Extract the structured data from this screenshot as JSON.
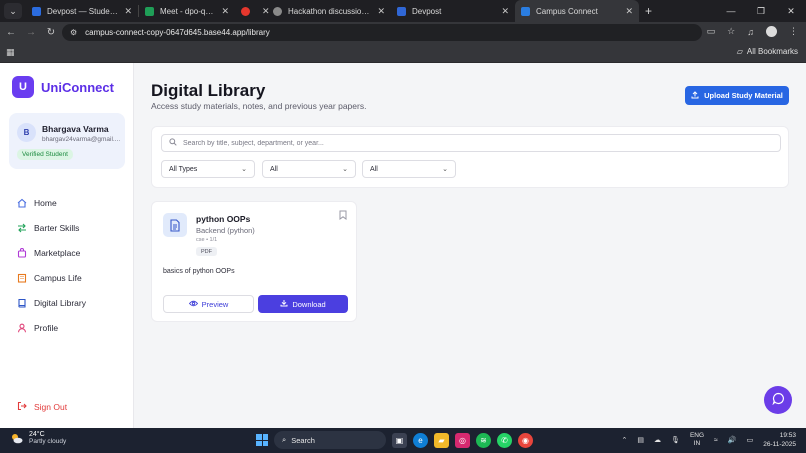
{
  "browser": {
    "tabs": [
      {
        "title": "Devpost — Student Guide for H",
        "color": "#2b6cdf",
        "active": false
      },
      {
        "title": "Meet - dpo-qcyk-fah",
        "color": "#1f9e57",
        "active": false
      },
      {
        "title": "",
        "color": "#e5372d",
        "active": false
      },
      {
        "title": "Hackathon discussion topics",
        "color": "#8a8a8a",
        "active": false
      },
      {
        "title": "Devpost",
        "color": "#3067d6",
        "active": false
      },
      {
        "title": "Campus Connect",
        "color": "#2a7de1",
        "active": true
      }
    ],
    "url": "campus-connect-copy-0647d645.base44.app/library",
    "bookmarks_label": "All Bookmarks"
  },
  "app": {
    "brand_letter": "U",
    "brand_name": "UniConnect",
    "user": {
      "initial": "B",
      "name": "Bhargava Varma",
      "email": "bhargav24varma@gmail....",
      "badge": "Verified Student"
    },
    "nav": [
      {
        "label": "Home",
        "icon": "home-icon"
      },
      {
        "label": "Barter Skills",
        "icon": "swap-icon"
      },
      {
        "label": "Marketplace",
        "icon": "shopping-bag-icon"
      },
      {
        "label": "Campus Life",
        "icon": "building-icon"
      },
      {
        "label": "Digital Library",
        "icon": "book-icon"
      },
      {
        "label": "Profile",
        "icon": "user-icon"
      }
    ],
    "signout": "Sign Out"
  },
  "main": {
    "title": "Digital Library",
    "subtitle": "Access study materials, notes, and previous year papers.",
    "upload_label": "Upload Study Material",
    "search_placeholder": "Search by title, subject, department, or year...",
    "filters": [
      {
        "value": "All Types"
      },
      {
        "value": "All"
      },
      {
        "value": "All"
      }
    ],
    "card": {
      "title": "python OOPs",
      "subtitle": "Backend (python)",
      "meta": "cse • 1/1",
      "badge": "PDF",
      "description": "basics of python OOPs",
      "preview_label": "Preview",
      "download_label": "Download"
    }
  },
  "taskbar": {
    "temp": "24°C",
    "weather": "Partly cloudy",
    "search_label": "Search",
    "lang_1": "ENG",
    "lang_2": "IN",
    "time": "19:53",
    "date": "26-11-2025"
  },
  "colors": {
    "brand": "#5b2ee6",
    "primary_button": "#2866e3",
    "download_button": "#4b3fe0",
    "signout": "#e23b3b"
  }
}
